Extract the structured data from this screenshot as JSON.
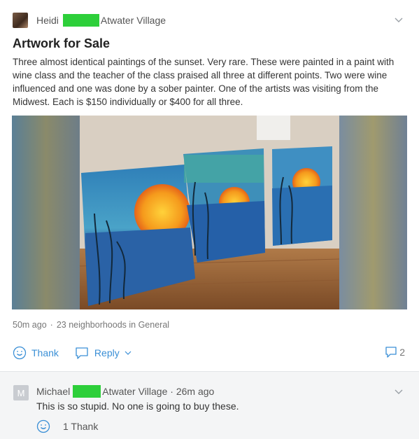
{
  "post": {
    "author": "Heidi",
    "neighborhood": "Atwater Village",
    "title": "Artwork for Sale",
    "body": "Three almost identical paintings of the sunset. Very rare. These were painted in a paint with wine class and the teacher of the class praised all three at different points. Two were wine influenced and one was done by a sober painter. One of the artists was visiting from the Midwest. Each is $150 individually or $400 for all three.",
    "time": "50m ago",
    "audience": "23 neighborhoods in General",
    "actions": {
      "thank": "Thank",
      "reply": "Reply"
    },
    "comment_count": "2",
    "colors": {
      "accent": "#3a8fd6",
      "redaction": "#2dcf3a"
    }
  },
  "comment": {
    "avatar_letter": "M",
    "author": "Michael",
    "neighborhood_time": "Atwater Village · 26m ago",
    "text": "This is so stupid. No one is going to buy these.",
    "thanks": "1 Thank"
  },
  "icons": [
    "avatar-image",
    "chevron-down-icon",
    "smiley-icon",
    "speech-bubble-icon",
    "comment-icon"
  ]
}
